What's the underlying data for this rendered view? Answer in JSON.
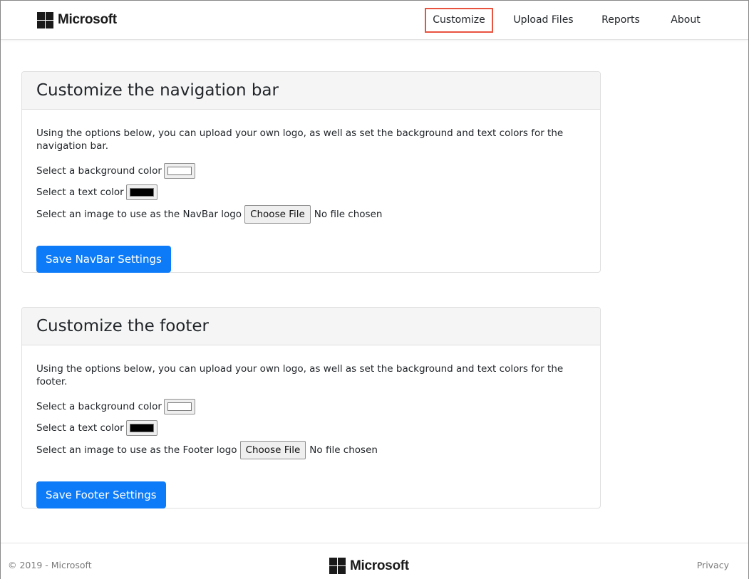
{
  "navbar": {
    "brand": "Microsoft",
    "items": [
      {
        "label": "Customize",
        "active": true
      },
      {
        "label": "Upload Files",
        "active": false
      },
      {
        "label": "Reports",
        "active": false
      },
      {
        "label": "About",
        "active": false
      }
    ]
  },
  "navbar_section": {
    "title": "Customize the navigation bar",
    "intro": "Using the options below, you can upload your own logo, as well as set the background and text colors for the navigation bar.",
    "bg_label": "Select a background color",
    "bg_color": "#ffffff",
    "text_label": "Select a text color",
    "text_color": "#000000",
    "logo_label": "Select an image to use as the NavBar logo",
    "choose_file": "Choose File",
    "no_file": "No file chosen",
    "save_label": "Save NavBar Settings"
  },
  "footer_section": {
    "title": "Customize the footer",
    "intro": "Using the options below, you can upload your own logo, as well as set the background and text colors for the footer.",
    "bg_label": "Select a background color",
    "bg_color": "#ffffff",
    "text_label": "Select a text color",
    "text_color": "#000000",
    "logo_label": "Select an image to use as the Footer logo",
    "choose_file": "Choose File",
    "no_file": "No file chosen",
    "save_label": "Save Footer Settings"
  },
  "footer": {
    "copyright": "© 2019 - Microsoft",
    "brand": "Microsoft",
    "privacy": "Privacy"
  },
  "colors": {
    "accent": "#0d7bf8",
    "active_outline": "#e8533f"
  }
}
